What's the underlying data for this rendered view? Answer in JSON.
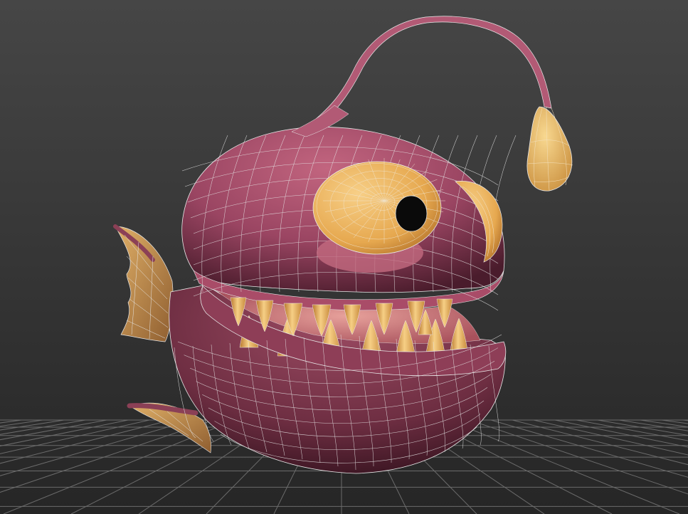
{
  "viewport": {
    "mode": "perspective",
    "shading": "smooth-with-wireframe-edges",
    "background_top": "#454545",
    "background_bottom": "#262626",
    "grid_color": "#6a6a6a",
    "wire_color": "#e8e8e8"
  },
  "model": {
    "subject": "cartoon-anglerfish",
    "body_color": "#a64f6a",
    "body_dark_color": "#5a2536",
    "mouth_color": "#d98a86",
    "eye_color": "#e6a84f",
    "pupil_color": "#0a0a0a",
    "tooth_color": "#e3a553",
    "fin_color": "#c9954e",
    "lure_color": "#e6b45a"
  }
}
